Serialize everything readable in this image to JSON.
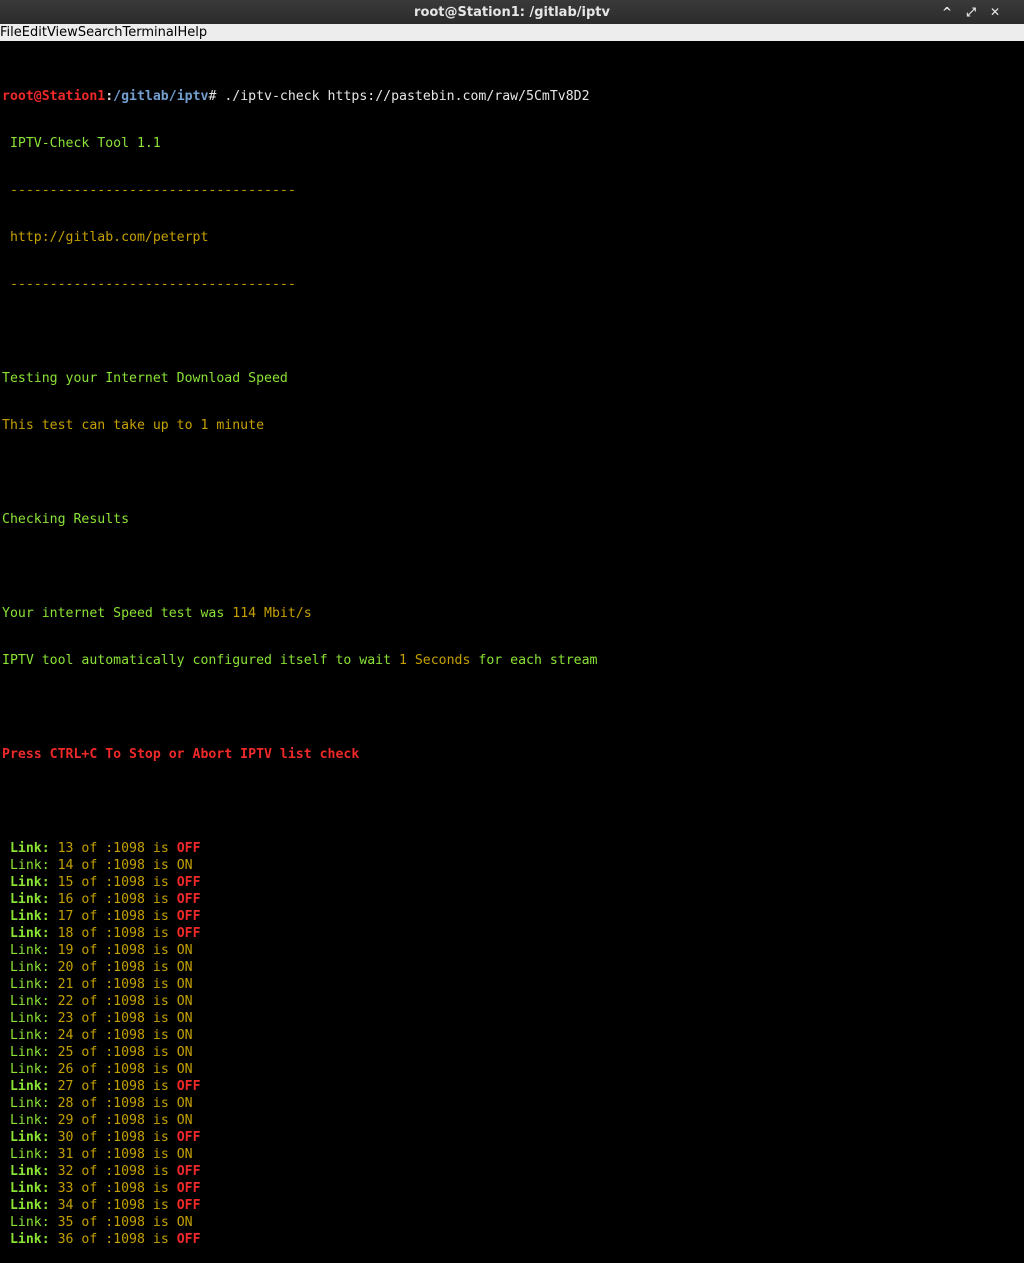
{
  "window": {
    "title": "root@Station1: /gitlab/iptv",
    "minimize": "^",
    "maximize": "⤢",
    "close": "✕"
  },
  "menu": [
    "File",
    "Edit",
    "View",
    "Search",
    "Terminal",
    "Help"
  ],
  "terminal": {
    "prompt_user": "root@Station1",
    "prompt_sep": ":",
    "prompt_path": "/gitlab/iptv",
    "prompt_hash": "#",
    "command": " ./iptv-check https://pastebin.com/raw/5CmTv8D2",
    "tool_name": " IPTV-Check Tool 1.1",
    "divider": " ------------------------------------",
    "url": " http://gitlab.com/peterpt",
    "testing": "Testing your Internet Download Speed",
    "take_up": "This test can take up to 1 minute",
    "checking": "Checking Results",
    "speed_prefix": "Your internet Speed test was ",
    "speed_value": "114 Mbit/s",
    "config_prefix": "IPTV tool automatically configured itself to wait ",
    "config_value": "1 Seconds",
    "config_suffix": " for each stream",
    "abort": "Press CTRL+C To Stop or Abort IPTV list check",
    "link_label": " Link:",
    "of_text": " of :1098 is ",
    "links": [
      {
        "n": "13",
        "status": "OFF"
      },
      {
        "n": "14",
        "status": "ON"
      },
      {
        "n": "15",
        "status": "OFF"
      },
      {
        "n": "16",
        "status": "OFF"
      },
      {
        "n": "17",
        "status": "OFF"
      },
      {
        "n": "18",
        "status": "OFF"
      },
      {
        "n": "19",
        "status": "ON"
      },
      {
        "n": "20",
        "status": "ON"
      },
      {
        "n": "21",
        "status": "ON"
      },
      {
        "n": "22",
        "status": "ON"
      },
      {
        "n": "23",
        "status": "ON"
      },
      {
        "n": "24",
        "status": "ON"
      },
      {
        "n": "25",
        "status": "ON"
      },
      {
        "n": "26",
        "status": "ON"
      },
      {
        "n": "27",
        "status": "OFF"
      },
      {
        "n": "28",
        "status": "ON"
      },
      {
        "n": "29",
        "status": "ON"
      },
      {
        "n": "30",
        "status": "OFF"
      },
      {
        "n": "31",
        "status": "ON"
      },
      {
        "n": "32",
        "status": "OFF"
      },
      {
        "n": "33",
        "status": "OFF"
      },
      {
        "n": "34",
        "status": "OFF"
      },
      {
        "n": "35",
        "status": "ON"
      },
      {
        "n": "36",
        "status": "OFF"
      }
    ]
  }
}
